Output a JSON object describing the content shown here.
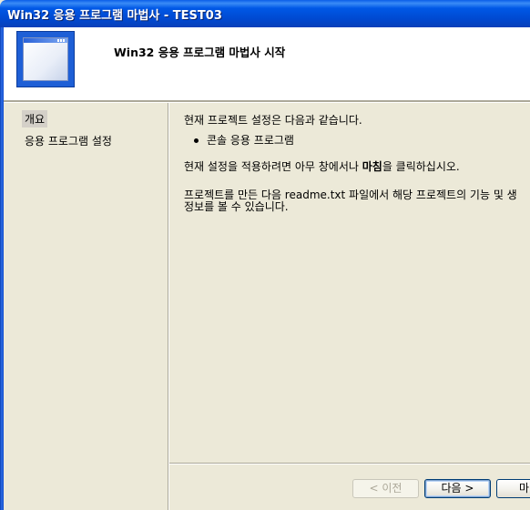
{
  "window": {
    "title": "Win32 응용 프로그램 마법사 - TEST03"
  },
  "header": {
    "title": "Win32 응용 프로그램 마법사 시작"
  },
  "nav": {
    "items": [
      {
        "label": "개요",
        "selected": true
      },
      {
        "label": "응용 프로그램 설정",
        "selected": false
      }
    ]
  },
  "content": {
    "line1": "현재 프로젝트 설정은 다음과 같습니다.",
    "bullet1": "콘솔 응용 프로그램",
    "line2_prefix": "현재 설정을 적용하려면 아무 창에서나 ",
    "line2_bold": "마침",
    "line2_suffix": "을 클릭하십시오.",
    "line3": "프로젝트를 만든 다음 readme.txt 파일에서 해당 프로젝트의 기능 및 생",
    "line4": "정보를 볼 수 있습니다."
  },
  "buttons": {
    "prev_label": "< 이전",
    "next_label": "다음 >",
    "finish_label": "마"
  }
}
